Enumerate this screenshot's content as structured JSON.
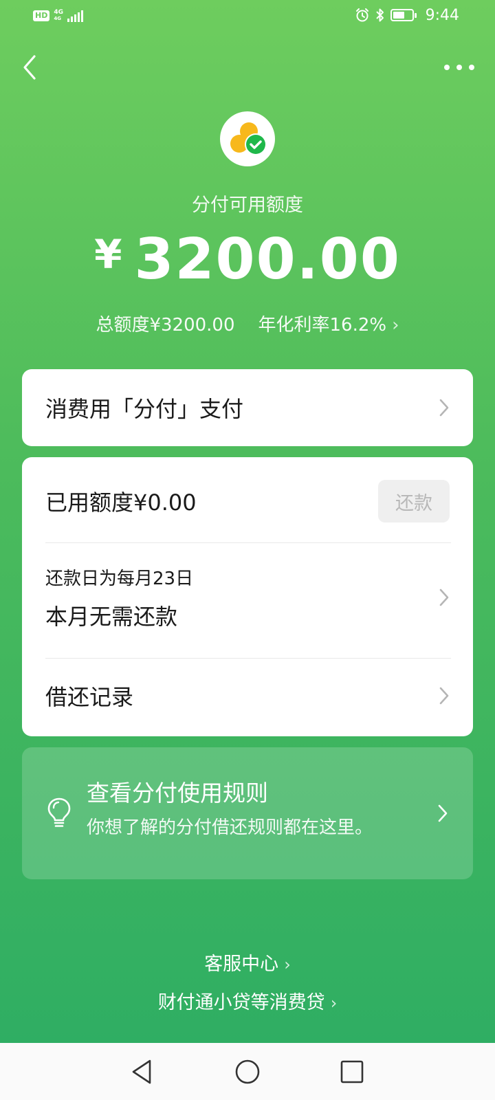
{
  "status_bar": {
    "hd": "HD",
    "network_top": "4G",
    "network_bottom": "4G",
    "time": "9:44",
    "battery_level": 0.6
  },
  "header": {
    "credit_label": "分付可用额度",
    "currency": "¥",
    "credit_amount": "3200.00",
    "total_limit": "总额度¥3200.00",
    "annual_rate": "年化利率16.2%"
  },
  "pay_card": {
    "label": "消费用「分付」支付"
  },
  "main_card": {
    "used_limit": "已用额度¥0.00",
    "repay_button": "还款",
    "repay_day": "还款日为每月23日",
    "repay_status": "本月无需还款",
    "records": "借还记录"
  },
  "rules_card": {
    "title": "查看分付使用规则",
    "desc": "你想了解的分付借还规则都在这里。"
  },
  "footer": {
    "service": "客服中心",
    "loan": "财付通小贷等消费贷"
  },
  "colors": {
    "gradient_top": "#6ecd5e",
    "gradient_bottom": "#2fae63",
    "logo_yellow": "#f7b81c",
    "logo_green": "#1fb84a"
  }
}
